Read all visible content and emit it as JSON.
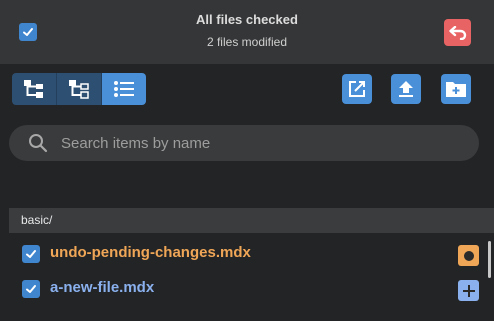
{
  "header": {
    "title": "All files checked",
    "subtitle": "2 files modified",
    "select_all_checked": true,
    "undo_icon": "undo-icon"
  },
  "toolbar": {
    "view_modes": [
      {
        "icon": "tree-collapsed-icon",
        "active": false
      },
      {
        "icon": "tree-expanded-icon",
        "active": false
      },
      {
        "icon": "list-icon",
        "active": true
      }
    ],
    "actions": [
      {
        "icon": "open-external-icon"
      },
      {
        "icon": "upload-icon"
      },
      {
        "icon": "new-folder-icon"
      }
    ]
  },
  "search": {
    "placeholder": "Search items by name",
    "value": ""
  },
  "folder": {
    "label": "basic/"
  },
  "files": [
    {
      "name": "undo-pending-changes.mdx",
      "status": "modified",
      "color": "#f0a657",
      "checked": true
    },
    {
      "name": "a-new-file.mdx",
      "status": "added",
      "color": "#8ab1ee",
      "checked": true
    }
  ],
  "colors": {
    "accent": "#4a90d9",
    "danger": "#e86363",
    "modified": "#f0a657",
    "added": "#8ab1ee"
  }
}
